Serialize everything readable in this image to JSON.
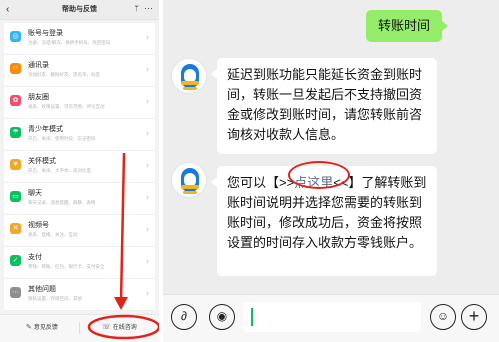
{
  "left_panel": {
    "header": {
      "back": "‹",
      "title": "帮助与反馈",
      "pin": "ᛘ",
      "more": "···"
    },
    "menu": [
      {
        "label": "账号与登录",
        "sub": "注册、冻结/解冻、换绑手机号、找回密码",
        "icon": "user-icon",
        "glyph": "◎",
        "color": "#2db7f5"
      },
      {
        "label": "通讯录",
        "sub": "添加好友、删除好友、黑名单、标签",
        "icon": "contacts-icon",
        "glyph": "☺",
        "color": "#ff8a00"
      },
      {
        "label": "朋友圈",
        "sub": "发表、权限设置、可见范围、评论互动",
        "icon": "moments-icon",
        "glyph": "✿",
        "color": "#f0506e"
      },
      {
        "label": "青少年模式",
        "sub": "开启、关闭、使用时段、忘记密码",
        "icon": "umbrella-icon",
        "glyph": "☂",
        "color": "#07c160"
      },
      {
        "label": "关怀模式",
        "sub": "开启、关闭、大字体、高对比度",
        "icon": "heart-icon",
        "glyph": "♥",
        "color": "#f5a623"
      },
      {
        "label": "聊天",
        "sub": "聊天记录、消息提醒、群聊、表情",
        "icon": "chat-icon",
        "glyph": "▭",
        "color": "#07c160"
      },
      {
        "label": "视频号",
        "sub": "发表、直播、关注、互动",
        "icon": "channels-icon",
        "glyph": "✕",
        "color": "#f5a623"
      },
      {
        "label": "支付",
        "sub": "零钱、转账、红包、银行卡、支付安全",
        "icon": "pay-icon",
        "glyph": "✓",
        "color": "#07c160"
      },
      {
        "label": "其他问题",
        "sub": "隐私设置、存储空间、其他",
        "icon": "more-icon",
        "glyph": "⋯",
        "color": "#8e8e93"
      }
    ],
    "footer": {
      "feedback_icon": "✎",
      "feedback": "意见反馈",
      "consult_icon": "☏",
      "consult": "在线咨询"
    }
  },
  "chat": {
    "my_message": "转账时间",
    "bot_message_1": "延迟到账功能只能延长资金到账时间，转账一旦发起后不支持撤回资金或修改到账时间，请您转账前咨询核对收款人信息。",
    "bot_message_2": {
      "prefix": "您可以【>>",
      "link": "点这里",
      "suffix": "<<】了解转账到账时间说明并选择您需要的转账到账时间，修改成功后，资金将按照设置的时间存入收款方零钱账户。"
    },
    "input_bar": {
      "link_icon": "∂",
      "voice_icon": "◉",
      "emoji_icon": "☺",
      "plus_icon": "+"
    }
  },
  "annotation_color": "#e2231a"
}
